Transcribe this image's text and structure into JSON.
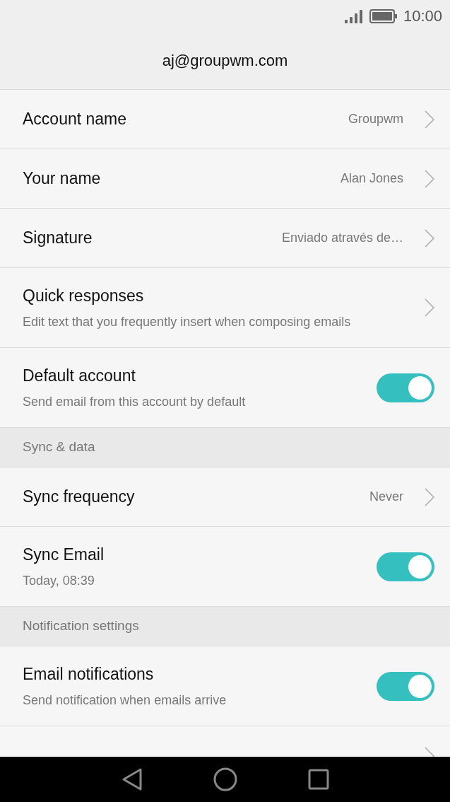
{
  "status_bar": {
    "time": "10:00"
  },
  "title": "aj@groupwm.com",
  "items": [
    {
      "kind": "link",
      "label": "Account name",
      "value": "Groupwm"
    },
    {
      "kind": "link",
      "label": "Your name",
      "value": "Alan Jones"
    },
    {
      "kind": "link",
      "label": "Signature",
      "value": "Enviado através de…"
    },
    {
      "kind": "link",
      "label": "Quick responses",
      "summary": "Edit text that you frequently insert when composing emails"
    },
    {
      "kind": "toggle",
      "label": "Default account",
      "summary": "Send email from this account by default",
      "on": true
    },
    {
      "kind": "header",
      "label": "Sync & data"
    },
    {
      "kind": "link",
      "label": "Sync frequency",
      "value": "Never"
    },
    {
      "kind": "toggle",
      "label": "Sync Email",
      "summary": "Today, 08:39",
      "on": true
    },
    {
      "kind": "header",
      "label": "Notification settings"
    },
    {
      "kind": "toggle",
      "label": "Email notifications",
      "summary": "Send notification when emails arrive",
      "on": true
    },
    {
      "kind": "link"
    }
  ]
}
